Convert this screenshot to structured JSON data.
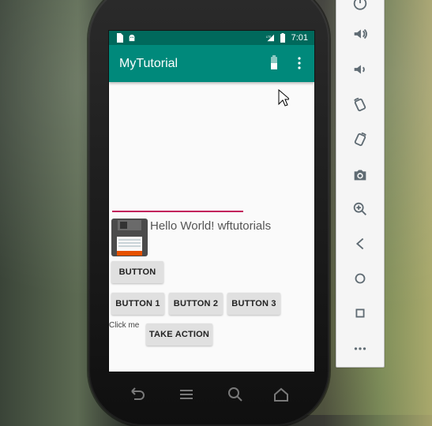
{
  "app": {
    "title": "MyTutorial",
    "colors": {
      "primary": "#00897b",
      "primary_dark": "#00695c",
      "accent_line": "#c2185b",
      "button_bg": "#e0e0e0",
      "screen_bg": "#fafafa"
    }
  },
  "statusbar": {
    "time": "7:01",
    "network_label": "LTE",
    "left_icons": [
      "sim-card-icon",
      "android-icon"
    ],
    "right_icons": [
      "lte-signal-icon",
      "battery-icon"
    ]
  },
  "appbar": {
    "actions": [
      {
        "name": "battery-action-icon"
      },
      {
        "name": "overflow-menu-icon"
      }
    ]
  },
  "content": {
    "hello_text": "Hello World! wftutorials",
    "button_label": "BUTTON",
    "row_buttons": [
      "BUTTON 1",
      "BUTTON 2",
      "BUTTON 3"
    ],
    "click_me_text": "Click me",
    "take_action_label": "TAKE ACTION",
    "image_icon": "floppy-disk-icon"
  },
  "phone_nav": [
    "back-icon",
    "menu-icon",
    "search-icon",
    "home-icon"
  ],
  "emulator_tools": [
    "power-icon",
    "volume-up-icon",
    "volume-down-icon",
    "rotate-left-icon",
    "rotate-right-icon",
    "camera-icon",
    "zoom-icon",
    "back-icon",
    "home-icon",
    "overview-icon",
    "more-icon"
  ]
}
